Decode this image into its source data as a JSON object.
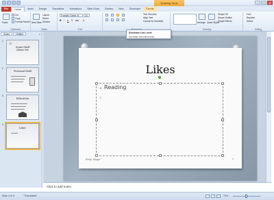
{
  "titlebar": {
    "context_tab": "Drawing Tools",
    "buttons": [
      "–",
      "□",
      "✕"
    ]
  },
  "tabs": [
    {
      "label": "File"
    },
    {
      "label": "Home"
    },
    {
      "label": "Insert"
    },
    {
      "label": "Design"
    },
    {
      "label": "Transitions"
    },
    {
      "label": "Animations"
    },
    {
      "label": "Slide Show"
    },
    {
      "label": "Review"
    },
    {
      "label": "View"
    },
    {
      "label": "Developer"
    },
    {
      "label": "Format"
    }
  ],
  "ribbon": {
    "clipboard": {
      "label": "Clipboard",
      "paste": "Paste",
      "cut": "Cut",
      "copy": "Copy",
      "format_painter": "Format Painter"
    },
    "slides": {
      "label": "Slides",
      "new_slide": "New Slide",
      "layout": "Layout",
      "reset": "Reset",
      "section": "Section"
    },
    "font": {
      "label": "Font",
      "font_name": "Franklin Gothic B",
      "font_size": "24"
    },
    "paragraph": {
      "label": "Paragraph",
      "text_direction": "Text Direction",
      "align_text": "Align Text",
      "smartart": "Convert to SmartArt"
    },
    "drawing": {
      "label": "Drawing",
      "arrange": "Arrange",
      "quick_styles": "Quick Styles",
      "shape_fill": "Shape Fill",
      "shape_outline": "Shape Outline",
      "shape_effects": "Shape Effects"
    },
    "editing": {
      "label": "Editing",
      "find": "Find",
      "replace": "Replace",
      "select": "Select"
    }
  },
  "tooltip": {
    "title": "Decrease List Level",
    "description": "Decrease the indent level."
  },
  "side_panel": {
    "tabs": [
      "Slides",
      "Outline"
    ],
    "close": "×",
    "slides": [
      {
        "number": "1",
        "title": "Some Stuff About Me"
      },
      {
        "number": "2",
        "title": "Personal Stuff"
      },
      {
        "number": "3",
        "title": "Education"
      },
      {
        "number": "4",
        "title": "Likes"
      }
    ]
  },
  "slide": {
    "title": "Likes",
    "bullets": [
      "Reading",
      ""
    ],
    "signature": "Prof. Hays",
    "page_number": "4"
  },
  "notes": {
    "placeholder": "Click to add notes"
  },
  "status": {
    "slide_info": "Slide 4 of 4",
    "theme": "\"Thumbtack\"",
    "zoom": "73%"
  },
  "colors": {
    "file_tab": "#c0392b",
    "context_tab": "#f0a93a",
    "selected_thumb": "#f2b33d"
  }
}
